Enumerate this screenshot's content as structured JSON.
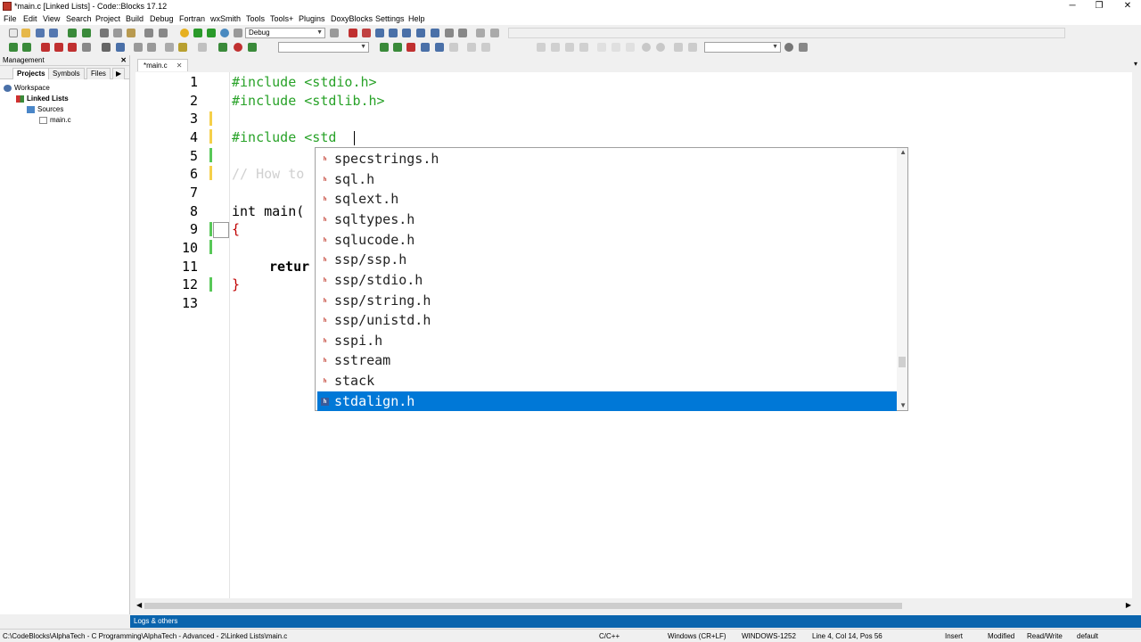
{
  "window": {
    "title": "*main.c [Linked Lists] - Code::Blocks 17.12",
    "minimize": "─",
    "maximize": "❐",
    "close": "✕"
  },
  "menu": [
    "File",
    "Edit",
    "View",
    "Search",
    "Project",
    "Build",
    "Debug",
    "Fortran",
    "wxSmith",
    "Tools",
    "Tools+",
    "Plugins",
    "DoxyBlocks",
    "Settings",
    "Help"
  ],
  "toolbar": {
    "build_target": "Debug"
  },
  "management": {
    "title": "Management",
    "close": "✕",
    "tabs": [
      "Projects",
      "Symbols",
      "Files"
    ],
    "active_tab": "Projects",
    "tree": {
      "workspace": "Workspace",
      "project": "Linked Lists",
      "folder": "Sources",
      "file": "main.c"
    }
  },
  "editor": {
    "tab_label": "*main.c",
    "tab_close": "✕",
    "line_numbers": [
      "1",
      "2",
      "3",
      "4",
      "5",
      "6",
      "7",
      "8",
      "9",
      "10",
      "11",
      "12",
      "13"
    ],
    "lines": {
      "l1": "#include <stdio.h>",
      "l2": "#include <stdlib.h>",
      "l4": "#include <std",
      "l6": "// How to",
      "l8_kw": "int",
      "l8_rest": " main(",
      "l9": "{",
      "l11": "retur",
      "l12": "}"
    }
  },
  "autocomplete": {
    "items": [
      "specstrings.h",
      "sql.h",
      "sqlext.h",
      "sqltypes.h",
      "sqlucode.h",
      "ssp/ssp.h",
      "ssp/stdio.h",
      "ssp/string.h",
      "ssp/unistd.h",
      "sspi.h",
      "sstream",
      "stack",
      "stdalign.h"
    ],
    "selected": "stdalign.h",
    "item_icon": "h"
  },
  "logs": {
    "label": "Logs & others"
  },
  "status": {
    "path": "C:\\CodeBlocks\\AlphaTech - C Programming\\AlphaTech - Advanced - 2\\Linked Lists\\main.c",
    "language": "C/C++",
    "line_endings": "Windows (CR+LF)",
    "encoding": "WINDOWS-1252",
    "position": "Line 4, Col 14, Pos 56",
    "mode": "Insert",
    "modified": "Modified",
    "access": "Read/Write",
    "profile": "default"
  }
}
